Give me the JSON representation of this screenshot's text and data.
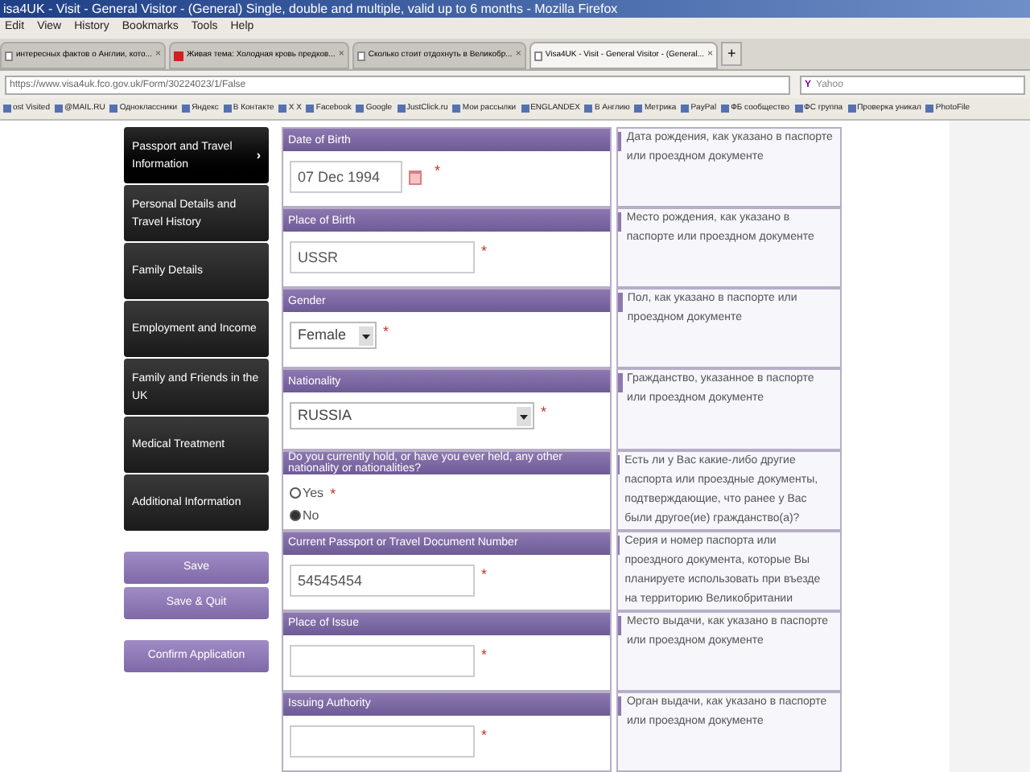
{
  "window": {
    "title": "isa4UK - Visit - General Visitor - (General) Single, double and multiple, valid up to 6 months - Mozilla Firefox"
  },
  "menu": [
    "Edit",
    "View",
    "History",
    "Bookmarks",
    "Tools",
    "Help"
  ],
  "tabs": [
    {
      "label": "интересных фактов о Англии, кото...",
      "selected": false,
      "kind": "page",
      "close": "×"
    },
    {
      "label": "Живая тема: Холодная кровь предков...",
      "selected": false,
      "kind": "video",
      "close": "×"
    },
    {
      "label": "Сколько стоит отдохнуть в Великобр...",
      "selected": false,
      "kind": "page",
      "close": "×"
    },
    {
      "label": "Visa4UK - Visit - General Visitor - (General...",
      "selected": true,
      "kind": "page",
      "close": "×"
    }
  ],
  "new_tab": "+",
  "url": "https://www.visa4uk.fco.gov.uk/Form/30224023/1/False",
  "search": {
    "logo": "Y",
    "placeholder": "Yahoo"
  },
  "bookmarks": [
    "ost Visited",
    "@MAIL.RU",
    "Одноклассники",
    "Яндекс",
    "В Контакте",
    "X X",
    "Facebook",
    "Google",
    "JustClick.ru",
    "Мои рассылки",
    "ENGLANDEX",
    "В Англию",
    "Метрика",
    "PayPal",
    "ФБ сообщество",
    "ФС группа",
    "Проверка уникал",
    "PhotoFile"
  ],
  "sidebar": {
    "items": [
      {
        "label": "Passport and Travel Information",
        "selected": true,
        "marker": "›"
      },
      {
        "label": "Personal Details and Travel History",
        "selected": false
      },
      {
        "label": "Family Details",
        "selected": false
      },
      {
        "label": "Employment and Income",
        "selected": false
      },
      {
        "label": "Family and Friends in the UK",
        "selected": false
      },
      {
        "label": "Medical Treatment",
        "selected": false
      },
      {
        "label": "Additional Information",
        "selected": false
      }
    ],
    "buttons": [
      "Save",
      "Save & Quit"
    ],
    "confirm_button": "Confirm Application"
  },
  "form": [
    {
      "label": "Date of Birth",
      "kind": "date",
      "value": "07 Dec 1994",
      "required": "*",
      "help": "Дата рождения, как указано в паспорте или проездном документе"
    },
    {
      "label": "Place of Birth",
      "kind": "text",
      "value": "USSR",
      "required": "*",
      "help": "Место рождения, как указано в паспорте или проездном документе"
    },
    {
      "label": "Gender",
      "kind": "select",
      "value": "Female",
      "required": "*",
      "help": "Пол, как указано в паспорте или проездном документе"
    },
    {
      "label": "Nationality",
      "kind": "wideselect",
      "value": "RUSSIA",
      "required": "*",
      "help": "Гражданство, указанное в паспорте или проездном документе"
    },
    {
      "label": "Do you currently hold, or have you ever held, any other nationality or nationalities?",
      "kind": "radio",
      "required": "*",
      "options": [
        {
          "label": "Yes",
          "selected": false
        },
        {
          "label": "No",
          "selected": true
        }
      ],
      "help": "Есть ли у Вас какие-либо другие паспорта или проездные документы, подтверждающие, что ранее у Вас были другое(ие) гражданство(а)?"
    },
    {
      "label": "Current Passport or Travel Document Number",
      "kind": "text",
      "value": "54545454",
      "required": "*",
      "help": "Серия и номер паспорта или проездного документа, которые Вы планируете использовать при въезде на территорию Великобритании"
    },
    {
      "label": "Place of Issue",
      "kind": "text",
      "required": "*",
      "help": "Место выдачи, как указано в паспорте или проездном документе"
    },
    {
      "label": "Issuing Authority",
      "kind": "text",
      "required": "*",
      "help": "Орган выдачи, как указано в паспорте или проездном документе"
    }
  ]
}
